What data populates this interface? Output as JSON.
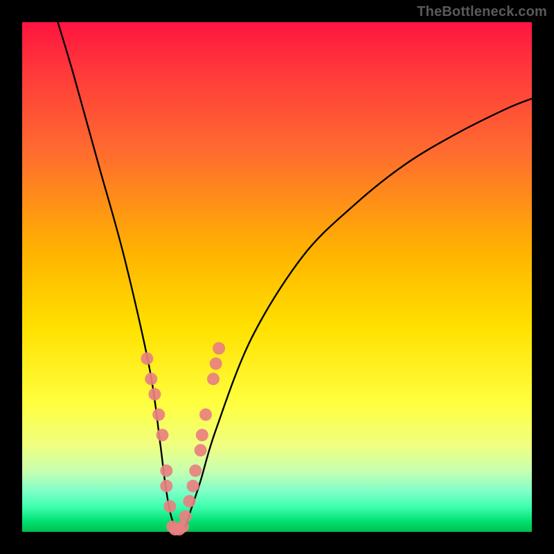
{
  "watermark": "TheBottleneck.com",
  "chart_data": {
    "type": "line",
    "title": "",
    "xlabel": "",
    "ylabel": "",
    "xlim": [
      0,
      100
    ],
    "ylim": [
      0,
      100
    ],
    "series": [
      {
        "name": "curve",
        "x": [
          7,
          10,
          15,
          20,
          25,
          27,
          28,
          29,
          30,
          31,
          32,
          33,
          35,
          38,
          45,
          55,
          65,
          75,
          85,
          95,
          100
        ],
        "y": [
          100,
          90,
          72,
          54,
          32,
          18,
          10,
          4,
          1,
          0,
          1,
          4,
          10,
          20,
          38,
          54,
          64,
          72,
          78,
          83,
          85
        ]
      }
    ],
    "markers": {
      "name": "points",
      "color": "#e98080",
      "x": [
        24.5,
        25.3,
        26.0,
        26.8,
        27.5,
        28.3,
        28.3,
        29.0,
        29.5,
        30.0,
        30.8,
        31.5,
        32.0,
        32.8,
        33.5,
        34.0,
        35.0,
        35.3,
        36.0,
        37.5,
        38.0,
        38.6
      ],
      "y": [
        34,
        30,
        27,
        23,
        19,
        12,
        9,
        5,
        1,
        0.5,
        0.5,
        1,
        3,
        6,
        9,
        12,
        16,
        19,
        23,
        30,
        33,
        36
      ]
    },
    "background_gradient": {
      "top": "#ff1440",
      "bottom": "#00c050"
    }
  }
}
